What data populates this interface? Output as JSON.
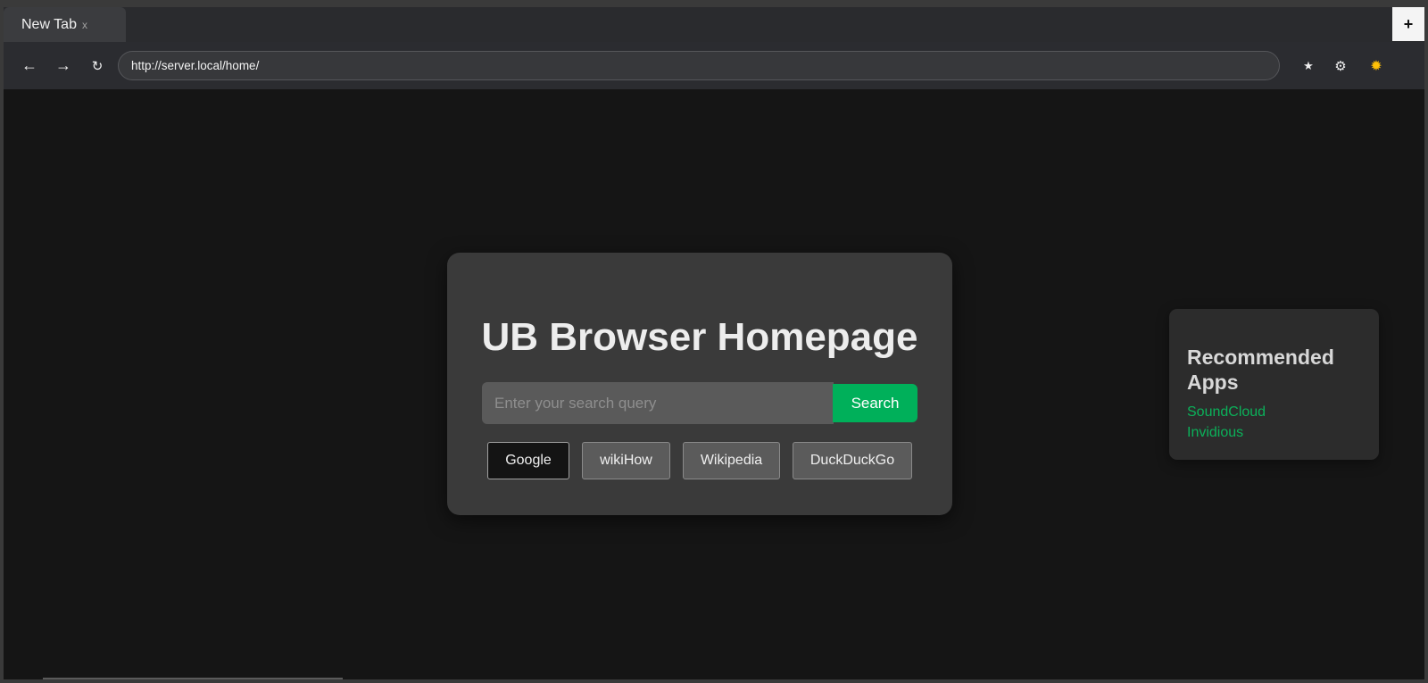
{
  "tabs": [
    {
      "title": "New Tab",
      "close": "x"
    }
  ],
  "new_tab_label": "+",
  "toolbar": {
    "back": "←",
    "forward": "→",
    "reload": "↻",
    "url": "http://server.local/home/",
    "star": "★",
    "gear": "⚙",
    "sun": "✹"
  },
  "main": {
    "title": "UB Browser Homepage",
    "search_placeholder": "Enter your search query",
    "search_button": "Search",
    "engines": [
      {
        "label": "Google",
        "selected": true
      },
      {
        "label": "wikiHow",
        "selected": false
      },
      {
        "label": "Wikipedia",
        "selected": false
      },
      {
        "label": "DuckDuckGo",
        "selected": false
      }
    ]
  },
  "recommended": {
    "title": "Recommended Apps",
    "apps": [
      "SoundCloud",
      "Invidious"
    ]
  },
  "colors": {
    "accent": "#00b05a",
    "background": "#151515",
    "card": "#3a3a3a",
    "toolbar": "#2b2c30"
  }
}
